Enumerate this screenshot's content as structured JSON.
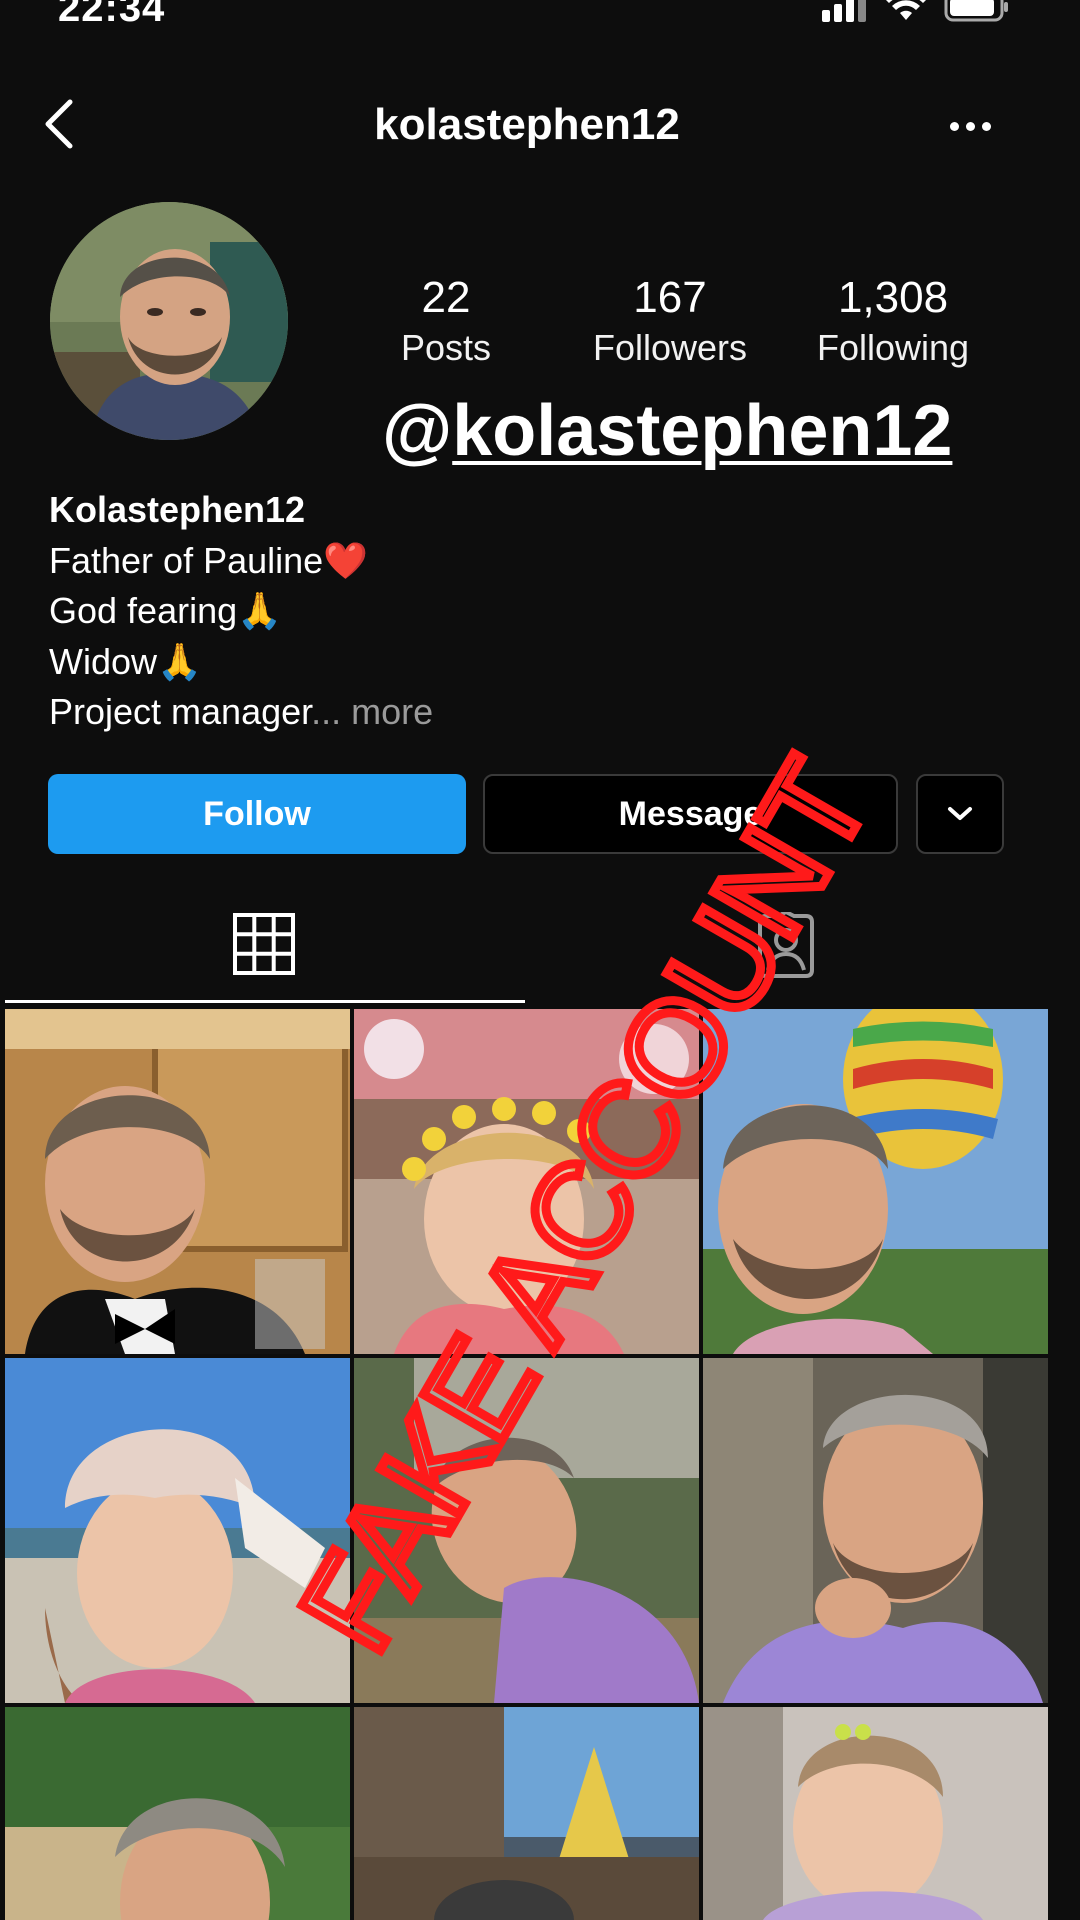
{
  "status_bar": {
    "time": "22:34"
  },
  "header": {
    "title": "kolastephen12"
  },
  "profile": {
    "stats": [
      {
        "value": "22",
        "label": "Posts"
      },
      {
        "value": "167",
        "label": "Followers"
      },
      {
        "value": "1,308",
        "label": "Following"
      }
    ],
    "handle_overlay": {
      "at": "@",
      "handle": "kolastephen12"
    },
    "bio": {
      "name": "Kolastephen12",
      "lines": [
        "Father of Pauline❤️",
        "God fearing🙏",
        "Widow🙏"
      ],
      "last_line": "Project manager",
      "ellipsis": "...",
      "more_label": " more"
    }
  },
  "actions": {
    "follow_label": "Follow",
    "message_label": "Message"
  },
  "watermark": {
    "text": "FAKE ACCOUNT",
    "color": "#ff1a1a"
  },
  "icons": {
    "back": "chevron-left-icon",
    "more": "more-horizontal-icon",
    "grid": "grid-icon",
    "tagged": "tagged-person-icon",
    "dropdown": "chevron-down-icon"
  },
  "accent_colors": {
    "follow_button": "#1d9bf0",
    "background": "#0d0d0d"
  }
}
